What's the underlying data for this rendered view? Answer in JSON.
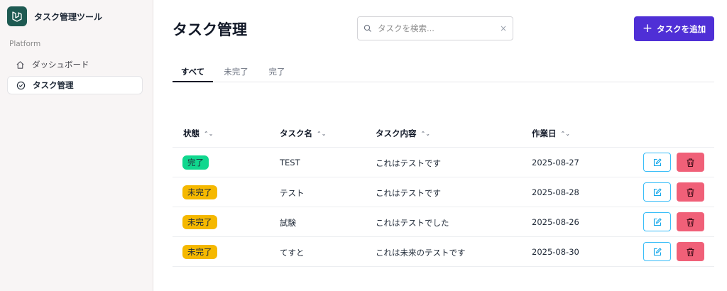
{
  "app": {
    "name": "タスク管理ツール"
  },
  "sidebar": {
    "section_label": "Platform",
    "items": [
      {
        "label": "ダッシュボード",
        "icon": "home-icon"
      },
      {
        "label": "タスク管理",
        "icon": "check-circle-icon",
        "active": true
      }
    ]
  },
  "header": {
    "title": "タスク管理",
    "search_placeholder": "タスクを検索...",
    "add_label": "タスクを追加"
  },
  "tabs": [
    {
      "label": "すべて",
      "active": true
    },
    {
      "label": "未完了"
    },
    {
      "label": "完了"
    }
  ],
  "table": {
    "columns": [
      "状態",
      "タスク名",
      "タスク内容",
      "作業日"
    ],
    "sort_indicator": "⌃⌄",
    "rows": [
      {
        "status": "完了",
        "status_type": "done",
        "name": "TEST",
        "content": "これはテストです",
        "date": "2025-08-27"
      },
      {
        "status": "未完了",
        "status_type": "todo",
        "name": "テスト",
        "content": "これはテストです",
        "date": "2025-08-28"
      },
      {
        "status": "未完了",
        "status_type": "todo",
        "name": "試験",
        "content": "これはテストでした",
        "date": "2025-08-26"
      },
      {
        "status": "未完了",
        "status_type": "todo",
        "name": "てすと",
        "content": "これは未来のテストです",
        "date": "2025-08-30"
      }
    ]
  },
  "colors": {
    "primary": "#4f2fd6",
    "status_done": "#10d78e",
    "status_todo": "#f5b800",
    "edit_border": "#38bdf8",
    "delete": "#f06078",
    "logo_bg": "#1e5a52"
  }
}
